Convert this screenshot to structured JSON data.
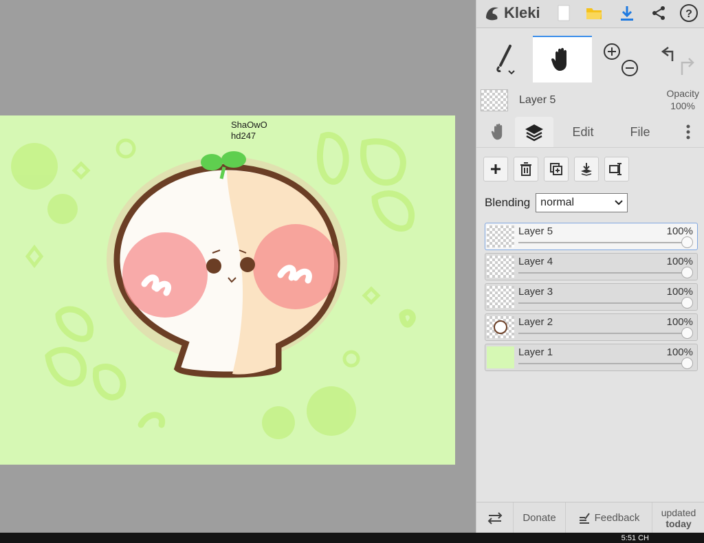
{
  "app": {
    "name": "Kleki"
  },
  "canvas": {
    "background_color": "#d6f8b4",
    "signature_lines": [
      "ShaOwO",
      "hd247"
    ]
  },
  "topbar": {
    "icons": [
      "new-file-icon",
      "open-folder-icon",
      "download-icon",
      "share-icon",
      "help-icon"
    ]
  },
  "tools": {
    "brush": "brush-icon",
    "hand": "hand-icon",
    "zoom_in": "zoom-in-icon",
    "zoom_out": "zoom-out-icon",
    "undo": "undo-icon",
    "redo": "redo-icon"
  },
  "current_layer": {
    "name": "Layer 5",
    "opacity_label": "Opacity",
    "opacity_value": "100%"
  },
  "tabs": {
    "edit": "Edit",
    "file": "File"
  },
  "blending": {
    "label": "Blending",
    "value": "normal"
  },
  "layers": [
    {
      "name": "Layer 5",
      "opacity": "100%",
      "active": true
    },
    {
      "name": "Layer 4",
      "opacity": "100%",
      "active": false
    },
    {
      "name": "Layer 3",
      "opacity": "100%",
      "active": false
    },
    {
      "name": "Layer 2",
      "opacity": "100%",
      "active": false
    },
    {
      "name": "Layer 1",
      "opacity": "100%",
      "active": false
    }
  ],
  "footer": {
    "donate": "Donate",
    "feedback": "Feedback",
    "updated_line1": "updated",
    "updated_line2": "today"
  },
  "taskbar": {
    "clock": "5:51 CH"
  }
}
